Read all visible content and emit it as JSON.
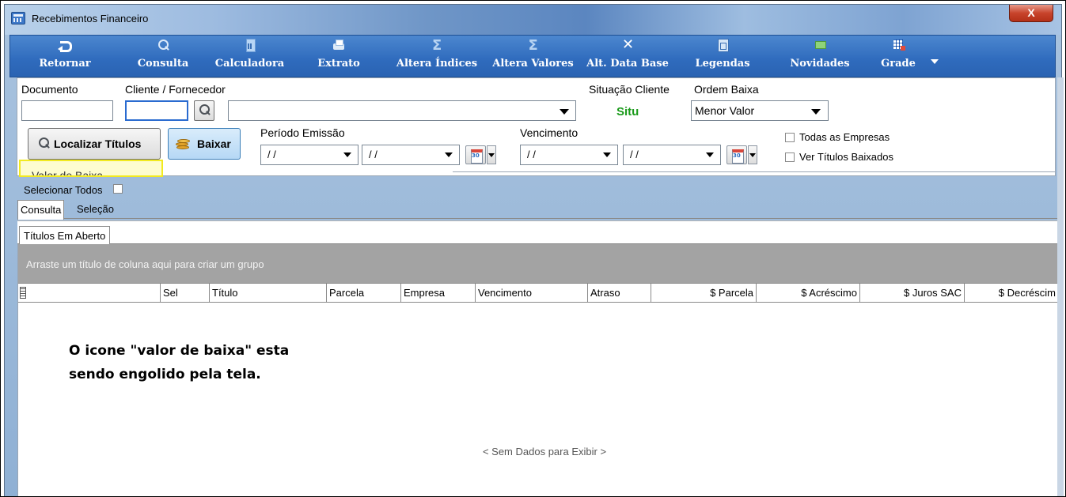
{
  "window": {
    "title": "Recebimentos Financeiro",
    "close_label": "X"
  },
  "toolbar": {
    "items": [
      {
        "label": "Retornar",
        "icon": "back-arrow-icon"
      },
      {
        "label": "Consulta",
        "icon": "search-icon"
      },
      {
        "label": "Calculadora",
        "icon": "calculator-icon"
      },
      {
        "label": "Extrato",
        "icon": "printer-icon"
      },
      {
        "label": "Altera Índices",
        "icon": "sigma-icon"
      },
      {
        "label": "Altera Valores",
        "icon": "sigma-icon"
      },
      {
        "label": "Alt. Data Base",
        "icon": "tools-icon"
      },
      {
        "label": "Legendas",
        "icon": "legend-icon"
      },
      {
        "label": "Novidades",
        "icon": "news-icon"
      },
      {
        "label": "Grade",
        "icon": "grid-icon"
      }
    ]
  },
  "filters": {
    "documento_label": "Documento",
    "documento_value": "",
    "cliente_label": "Cliente / Fornecedor",
    "cliente_code_value": "",
    "cliente_name_value": "",
    "situacao_label": "Situação Cliente",
    "situacao_value": "Situ",
    "situacao_color": "#1a9a1a",
    "ordem_label": "Ordem Baixa",
    "ordem_value": "Menor Valor",
    "localizar_label": "Localizar Títulos",
    "baixar_label": "Baixar",
    "periodo_label": "Período Emissão",
    "periodo_start": "/ /",
    "periodo_end": "/ /",
    "vencimento_label": "Vencimento",
    "vencimento_start": "/ /",
    "vencimento_end": "/ /",
    "todas_empresas_label": "Todas as Empresas",
    "ver_baixados_label": "Ver Títulos Baixados",
    "valor_baixa_label": "Valor de Baixa",
    "highlight_color": "#f4f000"
  },
  "selection": {
    "select_all_label": "Selecionar Todos"
  },
  "tabs": {
    "outer": [
      "Consulta",
      "Seleção"
    ],
    "inner": [
      "Títulos Em Aberto"
    ]
  },
  "grid": {
    "group_hint": "Arraste um título de coluna aqui para criar um grupo",
    "columns": [
      "",
      "Sel",
      "Título",
      "Parcela",
      "Empresa",
      "Vencimento",
      "Atraso",
      "$ Parcela",
      "$ Acréscimo",
      "$ Juros SAC",
      "$ Decréscim"
    ],
    "empty_text": "< Sem Dados para Exibir >"
  },
  "annotation": {
    "line1": "O icone \"valor de baixa\" esta",
    "line2": "sendo engolido pela tela."
  }
}
